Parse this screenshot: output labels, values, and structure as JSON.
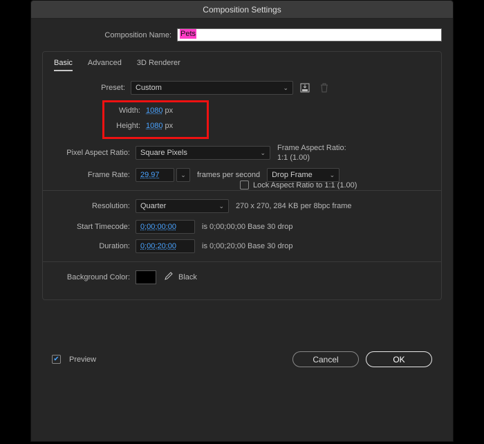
{
  "window": {
    "title": "Composition Settings"
  },
  "name": {
    "label": "Composition Name:",
    "value": "Pets"
  },
  "tabs": {
    "basic": "Basic",
    "advanced": "Advanced",
    "renderer": "3D Renderer"
  },
  "preset": {
    "label": "Preset:",
    "value": "Custom"
  },
  "dims": {
    "width_label": "Width:",
    "width": "1080",
    "px": "px",
    "height_label": "Height:",
    "height": "1080"
  },
  "lock": {
    "label": "Lock Aspect Ratio to 1:1 (1.00)"
  },
  "par": {
    "label": "Pixel Aspect Ratio:",
    "value": "Square Pixels",
    "info1": "Frame Aspect Ratio:",
    "info2": "1:1 (1.00)"
  },
  "fps": {
    "label": "Frame Rate:",
    "value": "29.97",
    "unit_label": "frames per second",
    "drop": "Drop Frame"
  },
  "res": {
    "label": "Resolution:",
    "value": "Quarter",
    "info": "270 x 270, 284 KB per 8bpc frame"
  },
  "start": {
    "label": "Start Timecode:",
    "value": "0;00;00;00",
    "info": "is 0;00;00;00  Base 30  drop"
  },
  "dur": {
    "label": "Duration:",
    "value": "0;00;20;00",
    "info": "is 0;00;20;00  Base 30  drop"
  },
  "bg": {
    "label": "Background Color:",
    "name": "Black"
  },
  "footer": {
    "preview": "Preview",
    "cancel": "Cancel",
    "ok": "OK"
  }
}
